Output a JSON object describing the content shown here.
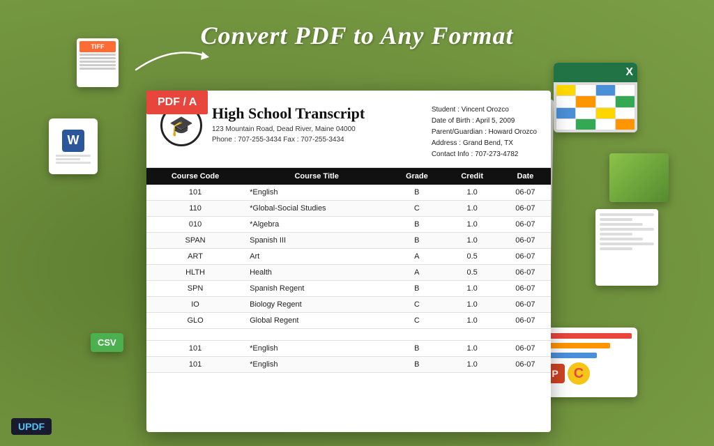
{
  "page": {
    "title": "Convert PDF to Any Format",
    "background_color": "#6b8c3a"
  },
  "header": {
    "title": "Convert PDF to Any Format"
  },
  "pdf_badge": "PDF / A",
  "document": {
    "title": "High School Transcript",
    "address": "123 Mountain Road, Dead River, Maine 04000",
    "phone": "Phone : 707-255-3434   Fax : 707-255-3434",
    "student": "Student : Vincent Orozco",
    "dob": "Date of Birth : April 5, 2009",
    "parent": "Parent/Guardian : Howard Orozco",
    "address_info": "Address : Grand Bend, TX",
    "contact": "Contact Info : 707-273-4782"
  },
  "table": {
    "headers": [
      "Course Code",
      "Course Title",
      "Grade",
      "Credit",
      "Date"
    ],
    "rows": [
      [
        "101",
        "*English",
        "B",
        "1.0",
        "06-07"
      ],
      [
        "110",
        "*Global-Social Studies",
        "C",
        "1.0",
        "06-07"
      ],
      [
        "010",
        "*Algebra",
        "B",
        "1.0",
        "06-07"
      ],
      [
        "SPAN",
        "Spanish III",
        "B",
        "1.0",
        "06-07"
      ],
      [
        "ART",
        "Art",
        "A",
        "0.5",
        "06-07"
      ],
      [
        "HLTH",
        "Health",
        "A",
        "0.5",
        "06-07"
      ],
      [
        "SPN",
        "Spanish Regent",
        "B",
        "1.0",
        "06-07"
      ],
      [
        "IO",
        "Biology Regent",
        "C",
        "1.0",
        "06-07"
      ],
      [
        "GLO",
        "Global Regent",
        "C",
        "1.0",
        "06-07"
      ]
    ],
    "bottom_rows": [
      [
        "101",
        "*English",
        "B",
        "1.0",
        "06-07"
      ],
      [
        "101",
        "*English",
        "B",
        "1.0",
        "06-07"
      ]
    ]
  },
  "floating": {
    "csv_label": "CSV",
    "word_label": "W",
    "excel_label": "X",
    "ppt_label": "P",
    "c_label": "C"
  },
  "updf": {
    "label": "UPDF"
  }
}
